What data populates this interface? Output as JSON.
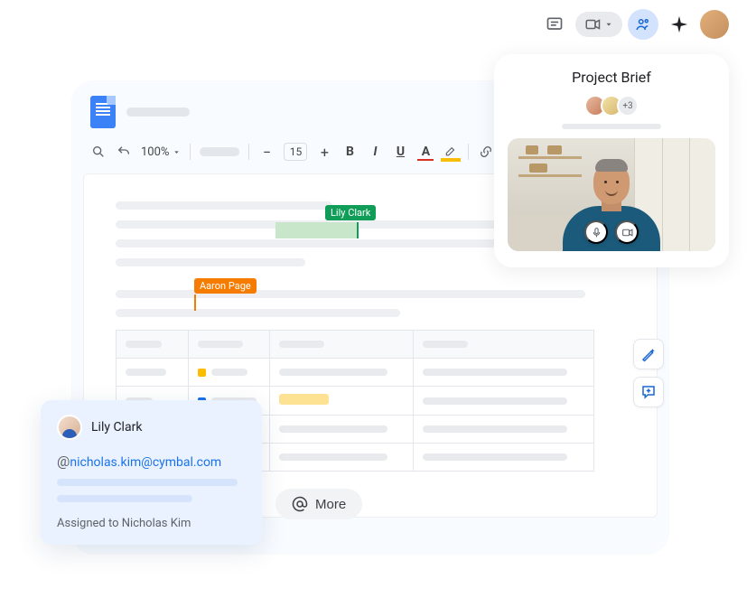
{
  "topbar": {
    "share_count_badge": null
  },
  "toolbar": {
    "zoom_value": "100%",
    "font_size": "15"
  },
  "cursors": {
    "green_label": "Lily Clark",
    "green_color": "#0f9d58",
    "orange_label": "Aaron Page",
    "orange_color": "#f57c00"
  },
  "table": {
    "col2_markers": [
      "#fbbc04",
      "#1a73e8",
      "#638e6f"
    ],
    "highlight_row": 1
  },
  "brief": {
    "title": "Project Brief",
    "extra_count": "+3"
  },
  "comment": {
    "author": "Lily Clark",
    "mention_prefix": "@",
    "mention": "nicholas.kim@cymbal.com",
    "assigned_text": "Assigned to Nicholas Kim"
  },
  "more": {
    "label": "More"
  }
}
